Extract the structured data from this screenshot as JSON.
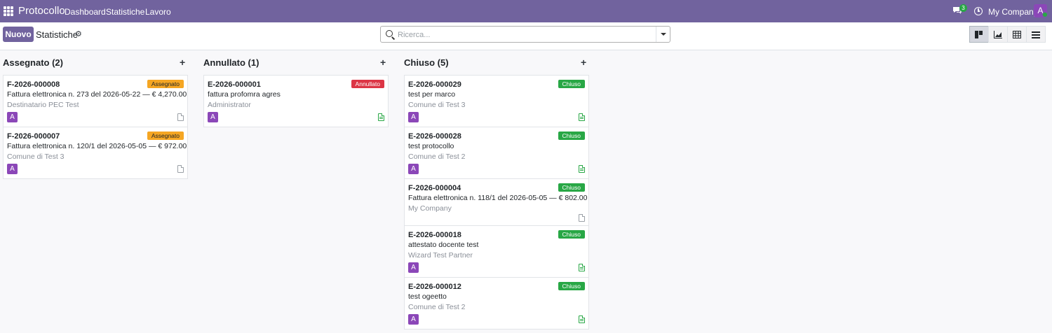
{
  "navbar": {
    "app_name": "Protocollo",
    "menu": [
      "Dashboard",
      "Statistiche",
      "Lavoro"
    ],
    "messages_count": "3",
    "company": "My Company",
    "user_initial": "A"
  },
  "control": {
    "new_button": "Nuovo",
    "breadcrumb": "Statistiche",
    "search_placeholder": "Ricerca...",
    "views": [
      "kanban-icon",
      "graph-icon",
      "pivot-icon",
      "list-icon"
    ]
  },
  "columns": [
    {
      "title": "Assegnato (2)",
      "cards": [
        {
          "ref": "F-2026-000008",
          "badge": "Assegnato",
          "subject": "Fattura elettronica n. 273 del 2026-05-22 — € 4,270.00",
          "partner": "Destinatario PEC Test",
          "avatar": "A",
          "attachment": "empty"
        },
        {
          "ref": "F-2026-000007",
          "badge": "Assegnato",
          "subject": "Fattura elettronica n. 120/1 del 2026-05-05 — € 972.00",
          "partner": "Comune di Test 3",
          "avatar": "A",
          "attachment": "empty"
        }
      ]
    },
    {
      "title": "Annullato (1)",
      "cards": [
        {
          "ref": "E-2026-000001",
          "badge": "Annullato",
          "subject": "fattura profomra agres",
          "partner": "Administrator",
          "avatar": "A",
          "attachment": "filled"
        }
      ]
    },
    {
      "title": "Chiuso (5)",
      "cards": [
        {
          "ref": "E-2026-000029",
          "badge": "Chiuso",
          "subject": "test per marco",
          "partner": "Comune di Test 3",
          "avatar": "A",
          "attachment": "filled"
        },
        {
          "ref": "E-2026-000028",
          "badge": "Chiuso",
          "subject": "test protocollo",
          "partner": "Comune di Test 2",
          "avatar": "A",
          "attachment": "filled"
        },
        {
          "ref": "F-2026-000004",
          "badge": "Chiuso",
          "subject": "Fattura elettronica n. 118/1 del 2026-05-05 — € 802.00",
          "partner": "My Company",
          "avatar": "",
          "attachment": "empty"
        },
        {
          "ref": "E-2026-000018",
          "badge": "Chiuso",
          "subject": "attestato docente test",
          "partner": "Wizard Test Partner",
          "avatar": "A",
          "attachment": "filled"
        },
        {
          "ref": "E-2026-000012",
          "badge": "Chiuso",
          "subject": "test ogeetto",
          "partner": "Comune di Test 2",
          "avatar": "A",
          "attachment": "filled"
        }
      ]
    }
  ]
}
